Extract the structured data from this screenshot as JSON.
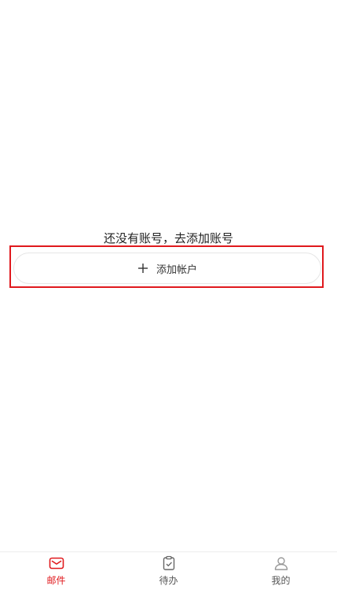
{
  "empty_state": {
    "message": "还没有账号，去添加账号",
    "add_button_label": "添加帐户"
  },
  "tabbar": {
    "tabs": [
      {
        "label": "邮件",
        "icon": "mail-icon",
        "active": true
      },
      {
        "label": "待办",
        "icon": "clipboard-check-icon",
        "active": false
      },
      {
        "label": "我的",
        "icon": "user-icon",
        "active": false
      }
    ]
  },
  "colors": {
    "accent": "#e0191d",
    "inactive": "#555555"
  }
}
